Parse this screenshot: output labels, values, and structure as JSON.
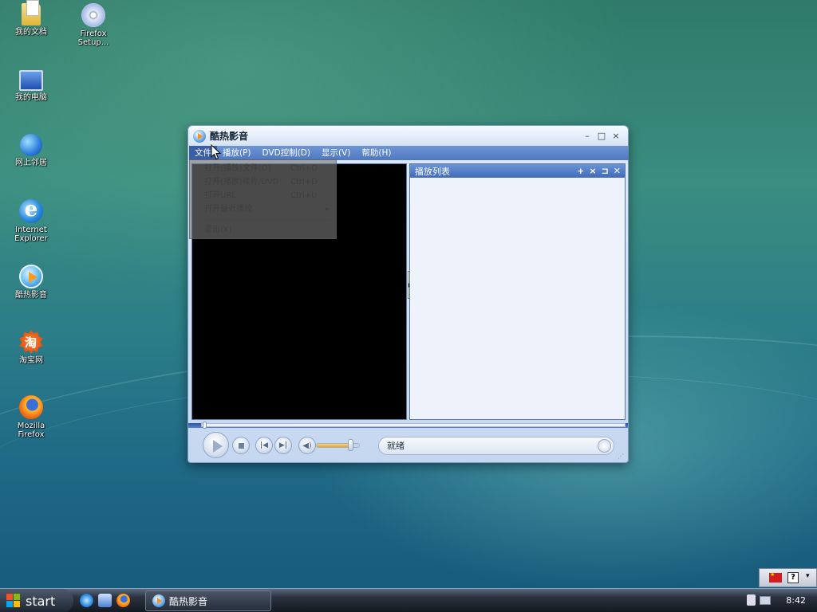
{
  "desktop": {
    "icons": [
      {
        "label": "我的文档",
        "icon": "folder-documents-icon"
      },
      {
        "label": "Firefox\nSetup...",
        "icon": "cd-installer-icon"
      },
      {
        "label": "我的电脑",
        "icon": "computer-icon"
      },
      {
        "label": "网上邻居",
        "icon": "network-icon"
      },
      {
        "label": "Internet\nExplorer",
        "icon": "internet-explorer-icon"
      },
      {
        "label": "酷热影音",
        "icon": "kuku-player-icon"
      },
      {
        "label": "淘宝网",
        "icon": "taobao-icon"
      },
      {
        "label": "Mozilla\nFirefox",
        "icon": "firefox-icon"
      }
    ]
  },
  "window": {
    "title": "酷热影音",
    "buttons": {
      "minimize": "–",
      "maximize": "□",
      "close": "×"
    },
    "menu": [
      {
        "label": "文件",
        "key": ""
      },
      {
        "label": "播放",
        "key": "(P)"
      },
      {
        "label": "DVD控制",
        "key": "(D)"
      },
      {
        "label": "显示",
        "key": "(V)"
      },
      {
        "label": "帮助",
        "key": "(H)"
      }
    ],
    "file_menu": [
      {
        "label": "打开(播放)文件(O)",
        "shortcut": "Ctrl+O"
      },
      {
        "label": "打开(播放)碟片/DVD",
        "shortcut": "Ctrl+D"
      },
      {
        "label": "打开URL",
        "shortcut": "Ctrl+U"
      },
      {
        "label": "打开最近播放",
        "shortcut": "",
        "submenu": "▸"
      },
      {
        "label": "退出(X)",
        "shortcut": ""
      }
    ],
    "playlist": {
      "title": "播放列表",
      "tools": [
        "+",
        "×",
        "⊐",
        "✕"
      ]
    },
    "status_text": "就绪",
    "volume_level": 0.75,
    "seek_position": 0.0
  },
  "taskbar": {
    "start_label": "start",
    "task_label": "酷热影音",
    "clock": "8:42"
  },
  "colors": {
    "accent": "#4f78c2",
    "menu_bar": "#5b83c8",
    "taskbar": "#1c232d"
  }
}
